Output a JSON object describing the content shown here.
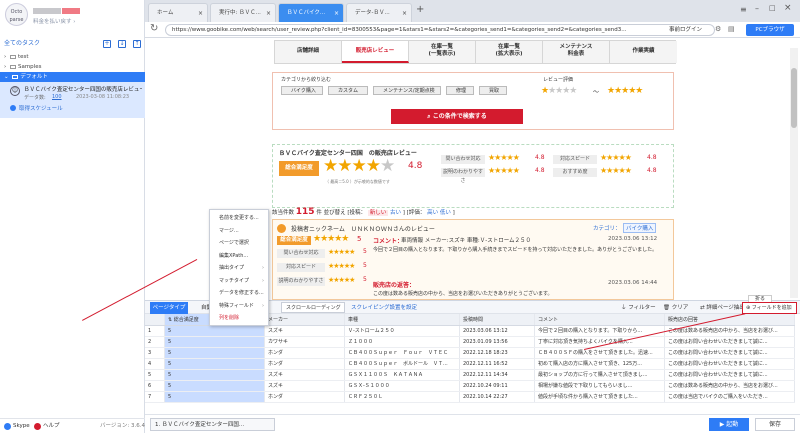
{
  "sidebar": {
    "logo_text": "Octo parse",
    "account_sub": "料金を払い戻す ›",
    "task_header": "全てのタスク",
    "tree": [
      {
        "label": "test"
      },
      {
        "label": "Samples"
      },
      {
        "label": "デフォルト"
      }
    ],
    "task": {
      "title": "ＢＶＣバイク査定センター四国の販売店レビュー",
      "count_label": "データ数:",
      "count": "100",
      "time": "2023-03-08 11:08:23",
      "status": "取得スケジュール"
    },
    "footer_skype": "Skype",
    "footer_help": "ヘルプ",
    "version": "バージョン: 3.6.4"
  },
  "tabs": [
    {
      "label": "ホーム"
    },
    {
      "label": "実行中: ＢＶＣ..."
    },
    {
      "label": "ＢＶＣバイク..."
    },
    {
      "label": "データ-ＢＶ..."
    }
  ],
  "address": {
    "url": "https://www.goobike.com/web/search/user_review.php?client_id=8300553&page=1&stars1=&stars2=&categories_send1=&categories_send2=&categories_send3...",
    "login": "事前ログイン",
    "pc_browser": "PCブラウザ"
  },
  "site_nav": [
    {
      "label": "店舗詳細"
    },
    {
      "label": "販売店レビュー"
    },
    {
      "label": "在庫一覧\n(一覧表示)"
    },
    {
      "label": "在庫一覧\n(拡大表示)"
    },
    {
      "label": "メンテナンス\n料金表"
    },
    {
      "label": "作業実績"
    }
  ],
  "filter": {
    "category_label": "カテゴリから絞り込む",
    "rating_label": "レビュー評価",
    "chips": [
      "バイク購入",
      "カスタム",
      "メンテナンス/定期点検",
      "修理",
      "買取"
    ],
    "tilde": "～",
    "search_button": "この条件で検索する"
  },
  "review_summary": {
    "title": "ＢＶＣバイク査定センター四国　の販売店レビュー",
    "badge": "総合満足度",
    "score": "4.8",
    "note": "（ 最高＝5.0 ）が示唆的な数値です",
    "items": [
      {
        "label": "問い合わせ対応",
        "score": "4.8"
      },
      {
        "label": "対応スピード",
        "score": "4.8"
      },
      {
        "label": "説明のわかりやすさ",
        "score": "4.8"
      },
      {
        "label": "おすすめ度",
        "score": "4.8"
      }
    ]
  },
  "list_header": {
    "count_label": "該当件数",
    "count": "115",
    "unit": "件",
    "sort_label": "並び替え [投稿：",
    "sort_new": "新しい",
    "sort_old": "古い",
    "rating_label": "] [評価：",
    "rating_high": "高い",
    "rating_low": "低い",
    "close": "]"
  },
  "review_card": {
    "header": "投稿者ニックネーム　ＵＮＫＮＯＷＮさんのレビュー",
    "category_label": "カテゴリ：",
    "category": "バイク購入",
    "badge": "総合満足度",
    "score": "5",
    "comment_label": "コメント：",
    "comment_meta": "車両情報 メーカー:スズキ 車種:Ｖ-ストローム２５０",
    "date": "2023.03.06 13:12",
    "body": "今回で２回目の購入となります。下取りから購入手続きまでスピードを持って対応いただきました。ありがとうございました。",
    "items": [
      {
        "label": "問い合わせ対応",
        "score": "5"
      },
      {
        "label": "対応スピード",
        "score": "5"
      },
      {
        "label": "説明のわかりやすさ",
        "score": "5"
      }
    ],
    "reply_label": "販売店の返答：",
    "reply_date": "2023.03.06 14:44",
    "reply_body": "この度は数ある販売店の中から、当店をお選びいただきありがとうございます。"
  },
  "context_menu": [
    {
      "label": "名前を変更する..."
    },
    {
      "label": "マージ..."
    },
    {
      "label": "ページで選択"
    },
    {
      "label": "編集XPath..."
    },
    {
      "label": "抽出タイプ"
    },
    {
      "label": "マッチタイプ"
    },
    {
      "label": "データを修正する..."
    },
    {
      "label": "特殊フィールド"
    },
    {
      "label": "列を削除"
    }
  ],
  "data_toolbar": {
    "tab": "ページタイプ",
    "auto": "自動",
    "scroll": "スクロールローディング",
    "flow": "スクレイピング設置を設定",
    "filter": "フィルター",
    "clear": "クリア",
    "detail": "詳細ページ抽出",
    "collapse": "折る",
    "add_field": "フィールドを追加"
  },
  "table": {
    "columns": [
      "総合満足度",
      "メーカー",
      "車種",
      "投稿時間",
      "コメント",
      "販売店の回答"
    ],
    "rows": [
      [
        "1",
        "5",
        "スズキ",
        "Ｖ-ストローム２５０",
        "2023.03.06 13:12",
        "今回で２回目の購入となります。下取りから...",
        "この度は数ある販売店の中から、当店をお選び..."
      ],
      [
        "2",
        "5",
        "カワサキ",
        "Ｚ１０００",
        "2023.01.09 13:56",
        "丁寧に対応頂き気持ちよくバイクを購入...",
        "この度はお問い合わせいただきまして誠に..."
      ],
      [
        "3",
        "5",
        "ホンダ",
        "ＣＢ４００Ｓｕｐｅｒ　Ｆｏｕｒ　ＶＴＥＣ",
        "2022.12.18 18:23",
        "ＣＢ４００ＳＦの購入をさせて頂きました。迅速...",
        "この度はお問い合わせいただきまして誠に..."
      ],
      [
        "4",
        "5",
        "ホンダ",
        "ＣＢ４００Ｓｕｐｅｒ　ボルドール　ＶＴ...",
        "2022.12.11 16:52",
        "初めて購入店の方に購入させて頂き、125万...",
        "この度はお問い合わせいただきまして誠に..."
      ],
      [
        "5",
        "5",
        "スズキ",
        "ＧＳＸ１１００Ｓ　ＫＡＴＡＮＡ",
        "2022.12.11 14:34",
        "最初ショップの方に行って購入させて頂きまし...",
        "この度はお問い合わせいただきまして誠に..."
      ],
      [
        "6",
        "5",
        "スズキ",
        "ＧＳＸ-Ｓ１０００",
        "2022.10.24 09:11",
        "相場が嫌な値段で下取りしてもらいまし...",
        "この度は数ある販売店の中から、当店をお選び..."
      ],
      [
        "7",
        "5",
        "ホンダ",
        "ＣＲＦ２５０Ｌ",
        "2022.10.14 22:27",
        "値段が手頃な件から購入させて頂きました...",
        "この度は当店でバイクのご購入をいただき..."
      ]
    ]
  },
  "status": {
    "tab_label": "1. ＢＶＣバイク査定センター四国...",
    "run": "▶ 起動",
    "save": "保存"
  },
  "colors": {
    "accent": "#2e7cf6",
    "brand_red": "#d31b2e",
    "star": "#f2a500"
  }
}
